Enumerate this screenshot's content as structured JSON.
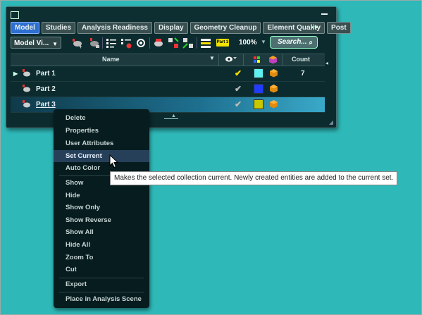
{
  "tabs": [
    "Model",
    "Studies",
    "Analysis Readiness",
    "Display",
    "Geometry Cleanup",
    "Element Quality",
    "Post"
  ],
  "toolbar": {
    "model_view": "Model Vi...",
    "part_badge": "Part 3",
    "zoom": "100%",
    "search_placeholder": "Search..."
  },
  "grid": {
    "headers": {
      "name": "Name",
      "count": "Count"
    },
    "rows": [
      {
        "label": "Part 1",
        "color": "#5ff0f0",
        "count": "7",
        "visible_check": "yellow",
        "expandable": true
      },
      {
        "label": "Part 2",
        "color": "#1f3cff",
        "count": "",
        "visible_check": "gray",
        "expandable": false
      },
      {
        "label": "Part 3",
        "color": "#c8c800",
        "count": "",
        "visible_check": "gray",
        "expandable": false
      }
    ]
  },
  "context_menu": {
    "items": [
      "Delete",
      "Properties",
      "User Attributes",
      "Set Current",
      "Auto Color",
      "Show",
      "Hide",
      "Show Only",
      "Show Reverse",
      "Show All",
      "Hide All",
      "Zoom To",
      "Cut",
      "Export",
      "Place in Analysis Scene"
    ],
    "highlighted": "Set Current"
  },
  "tooltip": "Makes the selected collection current. Newly created entities are added to the current set.",
  "colors": {
    "background": "#2fb8b8",
    "panel": "#0b2b2e",
    "active_tab": "#2e6fd0"
  }
}
